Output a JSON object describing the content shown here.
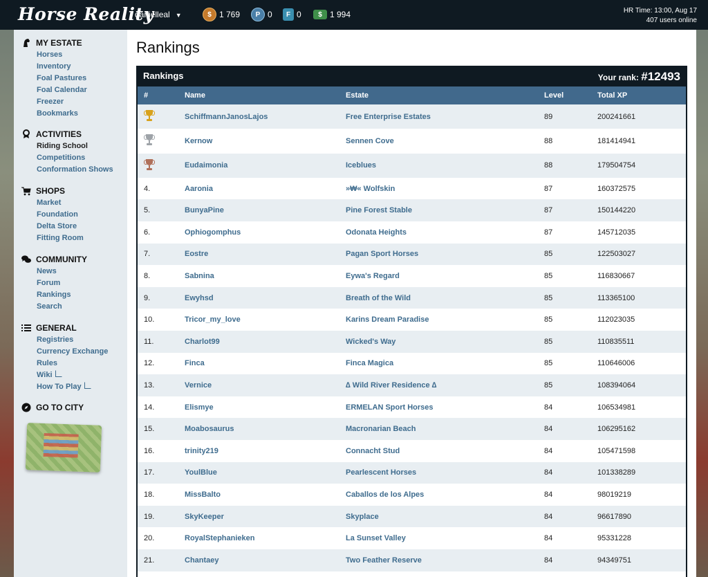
{
  "app": {
    "logo": "Horse Reality"
  },
  "header": {
    "username": "danielleal",
    "currencies": [
      {
        "name": "gold-coins",
        "value": "1 769"
      },
      {
        "name": "passes",
        "value": "0"
      },
      {
        "name": "foundation-points",
        "value": "0"
      },
      {
        "name": "cash",
        "value": "1 994"
      }
    ],
    "server_time": "HR Time: 13:00, Aug 17",
    "users_online": "407 users online"
  },
  "sidebar": {
    "sections": [
      {
        "title": "MY ESTATE",
        "icon": "horse-head-icon",
        "items": [
          "Horses",
          "Inventory",
          "Foal Pastures",
          "Foal Calendar",
          "Freezer",
          "Bookmarks"
        ]
      },
      {
        "title": "ACTIVITIES",
        "icon": "ribbon-icon",
        "items": [
          "Riding School",
          "Competitions",
          "Conformation Shows"
        ]
      },
      {
        "title": "SHOPS",
        "icon": "cart-icon",
        "items": [
          "Market",
          "Foundation",
          "Delta Store",
          "Fitting Room"
        ]
      },
      {
        "title": "COMMUNITY",
        "icon": "chat-bubbles-icon",
        "items": [
          "News",
          "Forum",
          "Rankings",
          "Search"
        ]
      },
      {
        "title": "GENERAL",
        "icon": "list-icon",
        "items": [
          "Registries",
          "Currency Exchange",
          "Rules",
          "Wiki",
          "How To Play"
        ]
      },
      {
        "title": "GO TO CITY",
        "icon": "compass-icon",
        "items": []
      }
    ]
  },
  "page": {
    "title": "Rankings"
  },
  "panel": {
    "title": "Rankings",
    "your_rank_label": "Your rank:",
    "your_rank_value": "#12493",
    "columns": [
      "#",
      "Name",
      "Estate",
      "Level",
      "Total XP"
    ],
    "rows": [
      {
        "rank": "1",
        "trophy": "gold",
        "name": "SchiffmannJanosLajos",
        "estate": "Free Enterprise Estates",
        "level": "89",
        "xp": "200241661"
      },
      {
        "rank": "2",
        "trophy": "silver",
        "name": "Kernow",
        "estate": "Sennen Cove",
        "level": "88",
        "xp": "181414941"
      },
      {
        "rank": "3",
        "trophy": "bronze",
        "name": "Eudaimonia",
        "estate": "Iceblues",
        "level": "88",
        "xp": "179504754"
      },
      {
        "rank": "4.",
        "name": "Aaronia",
        "estate": "»₩« Wolfskin",
        "level": "87",
        "xp": "160372575"
      },
      {
        "rank": "5.",
        "name": "BunyaPine",
        "estate": "Pine Forest Stable",
        "level": "87",
        "xp": "150144220"
      },
      {
        "rank": "6.",
        "name": "Ophiogomphus",
        "estate": "Odonata Heights",
        "level": "87",
        "xp": "145712035"
      },
      {
        "rank": "7.",
        "name": "Eostre",
        "estate": "Pagan Sport Horses",
        "level": "85",
        "xp": "122503027"
      },
      {
        "rank": "8.",
        "name": "Sabnina",
        "estate": "Eywa's Regard",
        "level": "85",
        "xp": "116830667"
      },
      {
        "rank": "9.",
        "name": "Ewyhsd",
        "estate": "Breath of the Wild",
        "level": "85",
        "xp": "113365100"
      },
      {
        "rank": "10.",
        "name": "Tricor_my_love",
        "estate": "Karins Dream Paradise",
        "level": "85",
        "xp": "112023035"
      },
      {
        "rank": "11.",
        "name": "Charlot99",
        "estate": "Wicked's Way",
        "level": "85",
        "xp": "110835511"
      },
      {
        "rank": "12.",
        "name": "Finca",
        "estate": "Finca Magica",
        "level": "85",
        "xp": "110646006"
      },
      {
        "rank": "13.",
        "name": "Vernice",
        "estate": "∆ Wild River Residence ∆",
        "level": "85",
        "xp": "108394064"
      },
      {
        "rank": "14.",
        "name": "Elismye",
        "estate": "ERMELAN Sport Horses",
        "level": "84",
        "xp": "106534981"
      },
      {
        "rank": "15.",
        "name": "Moabosaurus",
        "estate": "Macronarian Beach",
        "level": "84",
        "xp": "106295162"
      },
      {
        "rank": "16.",
        "name": "trinity219",
        "estate": "Connacht Stud",
        "level": "84",
        "xp": "105471598"
      },
      {
        "rank": "17.",
        "name": "YoulBlue",
        "estate": "Pearlescent Horses",
        "level": "84",
        "xp": "101338289"
      },
      {
        "rank": "18.",
        "name": "MissBalto",
        "estate": "Caballos de los Alpes",
        "level": "84",
        "xp": "98019219"
      },
      {
        "rank": "19.",
        "name": "SkyKeeper",
        "estate": "Skyplace",
        "level": "84",
        "xp": "96617890"
      },
      {
        "rank": "20.",
        "name": "RoyalStephanieken",
        "estate": "La Sunset Valley",
        "level": "84",
        "xp": "95331228"
      },
      {
        "rank": "21.",
        "name": "Chantaey",
        "estate": "Two Feather Reserve",
        "level": "84",
        "xp": "94349751"
      },
      {
        "rank": "22.",
        "name": "",
        "estate": "",
        "level": "",
        "xp": ""
      }
    ]
  }
}
